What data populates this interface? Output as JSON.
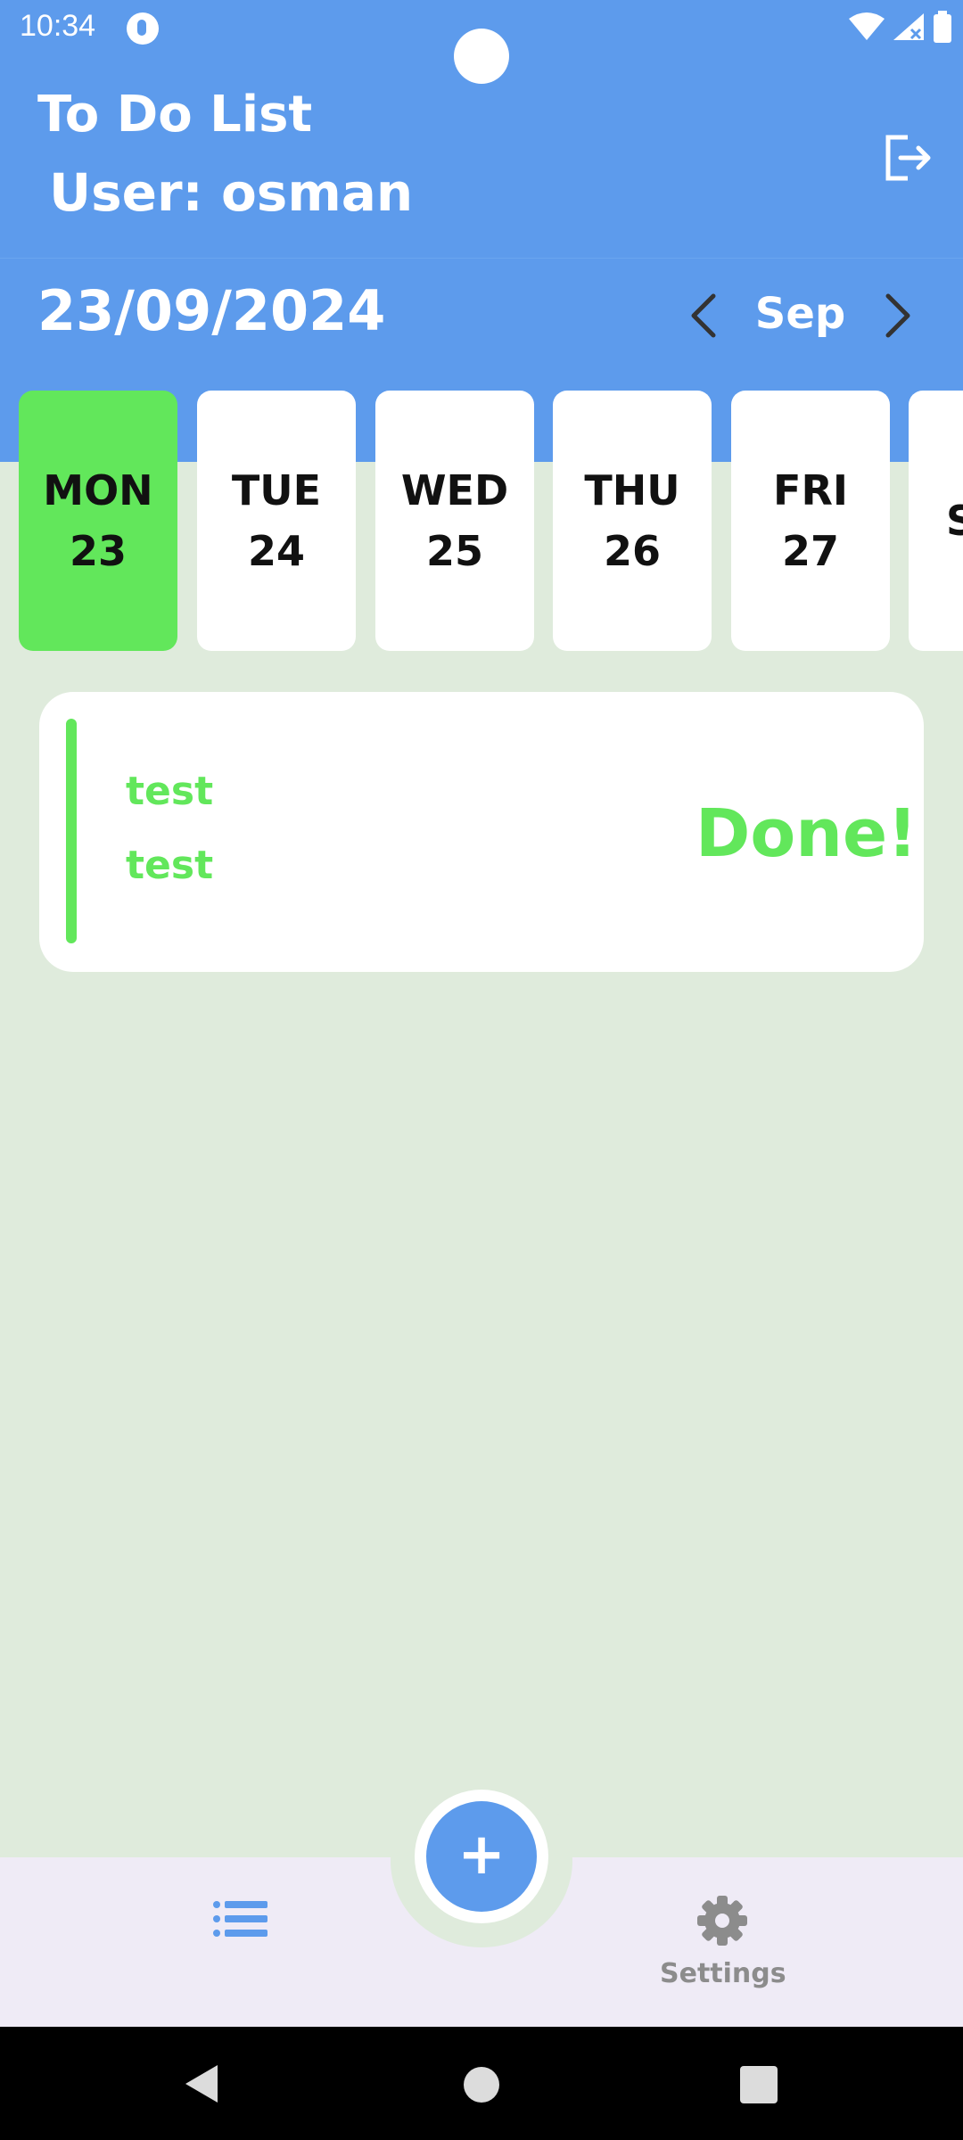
{
  "status_bar": {
    "time": "10:34"
  },
  "header": {
    "title": "To Do List",
    "user": "User: osman",
    "date": "23/09/2024",
    "month": "Sep"
  },
  "days": [
    {
      "name": "MON",
      "num": "23"
    },
    {
      "name": "TUE",
      "num": "24"
    },
    {
      "name": "WED",
      "num": "25"
    },
    {
      "name": "THU",
      "num": "26"
    },
    {
      "name": "FRI",
      "num": "27"
    },
    {
      "name": "S",
      "num": ""
    }
  ],
  "task": {
    "title": "test",
    "description": "test",
    "status": "Done!"
  },
  "bottom_nav": {
    "fab_label": "+",
    "settings_label": "Settings"
  },
  "colors": {
    "header": "#5d9bec",
    "accent": "#62e75b",
    "background": "#dfebdc"
  },
  "icons": [
    "logout-icon",
    "chevron-left-icon",
    "chevron-right-icon",
    "list-icon",
    "gear-icon",
    "plus-icon"
  ]
}
